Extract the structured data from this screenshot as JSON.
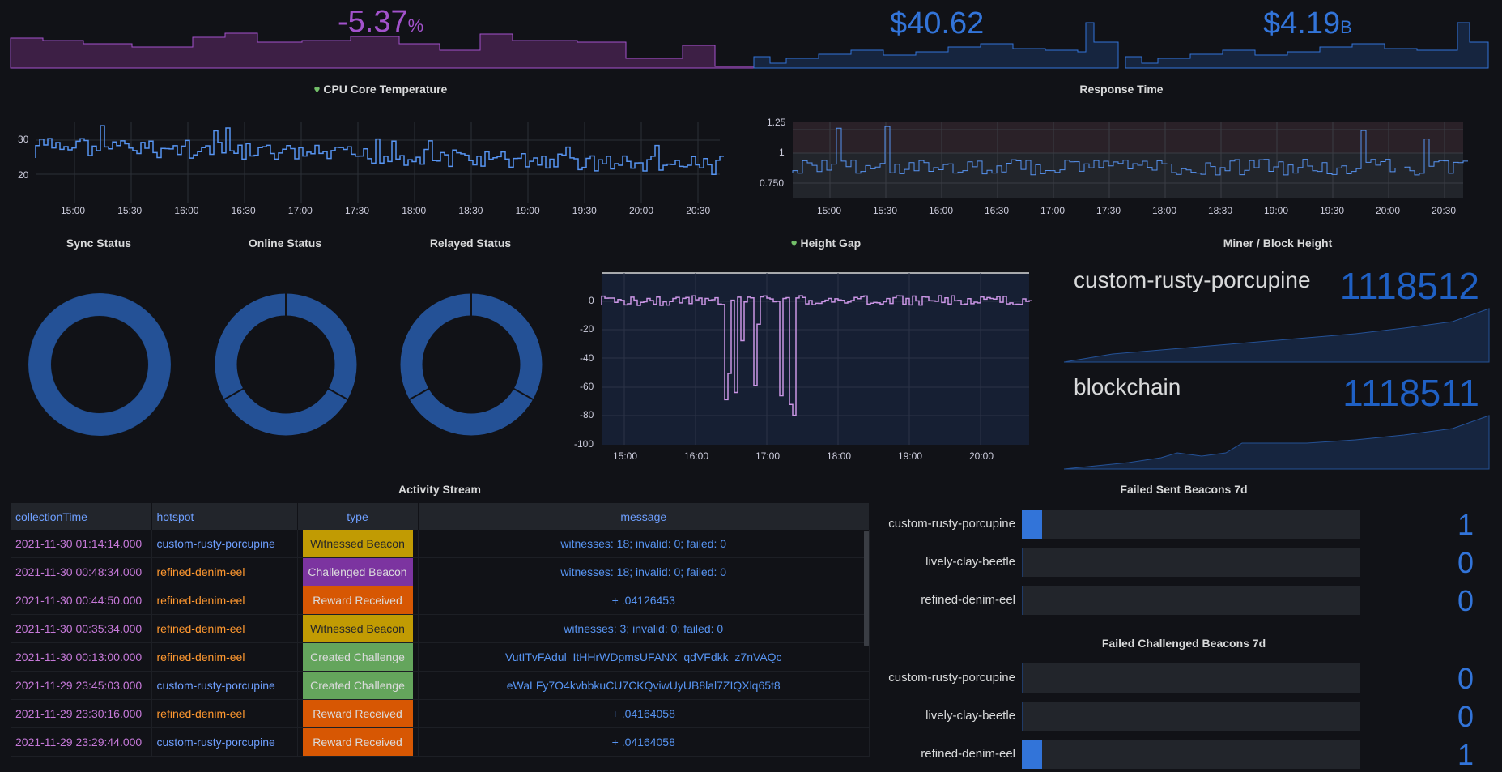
{
  "top_stats": {
    "pct": {
      "value": "-5.37",
      "unit": "%"
    },
    "price": {
      "value": "$40.62"
    },
    "cap": {
      "value": "$4.19",
      "unit": "B"
    }
  },
  "cpu_panel": {
    "title": "CPU Core Temperature",
    "y_ticks": [
      "30",
      "20"
    ],
    "x_ticks": [
      "15:00",
      "15:30",
      "16:00",
      "16:30",
      "17:00",
      "17:30",
      "18:00",
      "18:30",
      "19:00",
      "19:30",
      "20:00",
      "20:30"
    ]
  },
  "response_panel": {
    "title": "Response Time",
    "y_ticks": [
      "1.25",
      "1",
      "0.750"
    ],
    "x_ticks": [
      "15:00",
      "15:30",
      "16:00",
      "16:30",
      "17:00",
      "17:30",
      "18:00",
      "18:30",
      "19:00",
      "19:30",
      "20:00",
      "20:30"
    ]
  },
  "status_panels": {
    "sync": "Sync Status",
    "online": "Online Status",
    "relayed": "Relayed Status"
  },
  "height_gap": {
    "title": "Height Gap",
    "y_ticks": [
      "0",
      "-20",
      "-40",
      "-60",
      "-80",
      "-100"
    ],
    "x_ticks": [
      "15:00",
      "16:00",
      "17:00",
      "18:00",
      "19:00",
      "20:00"
    ]
  },
  "miner_block": {
    "title": "Miner / Block Height",
    "rows": [
      {
        "name": "custom-rusty-porcupine",
        "value": "1118512"
      },
      {
        "name": "blockchain",
        "value": "1118511"
      }
    ]
  },
  "activity": {
    "title": "Activity Stream",
    "columns": [
      "collectionTime",
      "hotspot",
      "type",
      "message"
    ],
    "rows": [
      {
        "time": "2021-11-30 01:14:14.000",
        "hotspot": "custom-rusty-porcupine",
        "type": "Witnessed Beacon",
        "message": "witnesses: 18; invalid: 0; failed: 0",
        "color": "#e0b400"
      },
      {
        "time": "2021-11-30 00:48:34.000",
        "hotspot": "refined-denim-eel",
        "type": "Challenged Beacon",
        "message": "witnesses: 18; invalid: 0; failed: 0",
        "color": "#8f3bb8"
      },
      {
        "time": "2021-11-30 00:44:50.000",
        "hotspot": "refined-denim-eel",
        "type": "Reward Received",
        "message": "+ .04126453",
        "color": "#fa6400"
      },
      {
        "time": "2021-11-30 00:35:34.000",
        "hotspot": "refined-denim-eel",
        "type": "Witnessed Beacon",
        "message": "witnesses: 3; invalid: 0; failed: 0",
        "color": "#e0b400"
      },
      {
        "time": "2021-11-30 00:13:00.000",
        "hotspot": "refined-denim-eel",
        "type": "Created Challenge",
        "message": "VutITvFAdul_ItHHrWDpmsUFANX_qdVFdkk_z7nVAQc",
        "color": "#73bf69"
      },
      {
        "time": "2021-11-29 23:45:03.000",
        "hotspot": "custom-rusty-porcupine",
        "type": "Created Challenge",
        "message": "eWaLFy7O4kvbbkuCU7CKQviwUyUB8lal7ZIQXlq65t8",
        "color": "#73bf69"
      },
      {
        "time": "2021-11-29 23:30:16.000",
        "hotspot": "refined-denim-eel",
        "type": "Reward Received",
        "message": "+ .04164058",
        "color": "#fa6400"
      },
      {
        "time": "2021-11-29 23:29:44.000",
        "hotspot": "custom-rusty-porcupine",
        "type": "Reward Received",
        "message": "+ .04164058",
        "color": "#fa6400"
      }
    ]
  },
  "failed_sent": {
    "title": "Failed Sent Beacons 7d",
    "rows": [
      {
        "name": "custom-rusty-porcupine",
        "value": "1",
        "level": 0.06
      },
      {
        "name": "lively-clay-beetle",
        "value": "0",
        "level": 0
      },
      {
        "name": "refined-denim-eel",
        "value": "0",
        "level": 0
      }
    ]
  },
  "failed_challenged": {
    "title": "Failed Challenged Beacons 7d",
    "rows": [
      {
        "name": "custom-rusty-porcupine",
        "value": "0",
        "level": 0
      },
      {
        "name": "lively-clay-beetle",
        "value": "0",
        "level": 0
      },
      {
        "name": "refined-denim-eel",
        "value": "1",
        "level": 0.06
      }
    ]
  },
  "colors": {
    "accent": "#3274d9",
    "purple": "#c679d9",
    "green": "#73bf69",
    "orange": "#fa6400"
  }
}
